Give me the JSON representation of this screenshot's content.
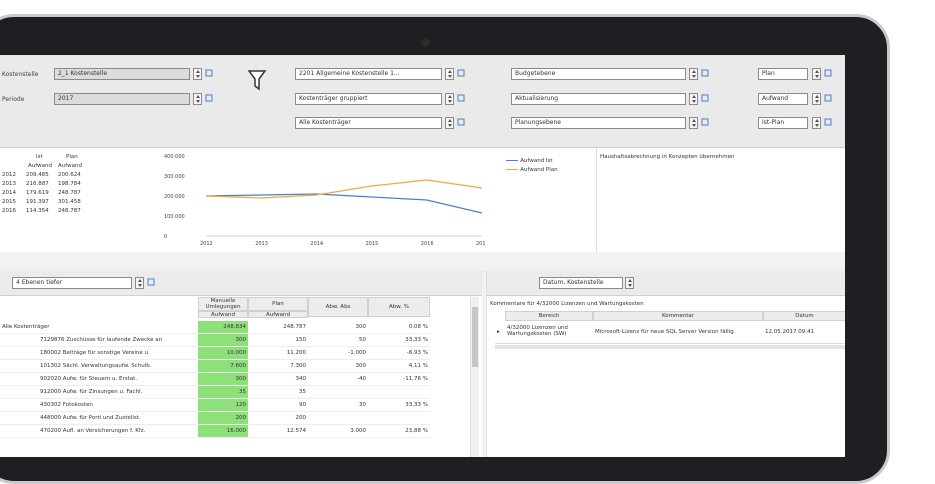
{
  "toolbar": {
    "kostenstelle_label": "Kostenstelle",
    "kostenstelle_value": "2_1 Kostenstelle",
    "periode_label": "Periode",
    "periode_value": "2017",
    "account_group": "2201 Allgemeine Kostenstelle 1...",
    "account_grouping": "Kostenträger gruppiert",
    "account_all": "Alle Kostenträger",
    "budget_1": "Budgetebene",
    "budget_2": "Aktualisierung",
    "budget_3": "Planungsebene",
    "plan_1": "Plan",
    "plan_2": "Aufwand",
    "plan_3": "Ist-Plan"
  },
  "summary": {
    "col_ist": "Ist",
    "col_plan": "Plan",
    "sub_ist": "Aufwand",
    "sub_plan": "Aufwand",
    "rows": [
      {
        "year": "2012",
        "ist": "209.485",
        "plan": "200.624"
      },
      {
        "year": "2013",
        "ist": "216.887",
        "plan": "198.784"
      },
      {
        "year": "2014",
        "ist": "179.619",
        "plan": "248.787"
      },
      {
        "year": "2015",
        "ist": "191.397",
        "plan": "301.458"
      },
      {
        "year": "2016",
        "ist": "114.354",
        "plan": "248.787"
      }
    ]
  },
  "chart_data": {
    "type": "line",
    "x": [
      "2012",
      "2013",
      "2014",
      "2015",
      "2016",
      "2017"
    ],
    "yticks": [
      "400.000",
      "300.000",
      "200.000",
      "100.000",
      "0"
    ],
    "ylim": [
      0,
      400000
    ],
    "series": [
      {
        "name": "Aufwand Ist",
        "color": "#4a7fd0",
        "values": [
          200000,
          205000,
          210000,
          195000,
          180000,
          115000
        ]
      },
      {
        "name": "Aufwand Plan",
        "color": "#f0a840",
        "values": [
          200000,
          190000,
          205000,
          250000,
          280000,
          240000
        ]
      }
    ]
  },
  "notes_title": "Haushaltsabrechnung in Konzepten übernehmen",
  "filter_value": "4 Ebenen tiefer",
  "table": {
    "headers": [
      "Manuelle Umlegungen",
      "Plan",
      "Abw. Abs",
      "Abw. %"
    ],
    "subheaders": [
      "Aufwand",
      "Aufwand"
    ],
    "rows": [
      {
        "name": "Alle Kostenträger",
        "manual": "248.834",
        "plan": "248.787",
        "abs": "300",
        "pct": "0,08 %"
      },
      {
        "name": "7129876 Zuschüsse für laufende Zwecke an",
        "manual": "300",
        "plan": "150",
        "abs": "50",
        "pct": "33,33 %"
      },
      {
        "name": "180002 Beiträge für sonstige Vereine u.",
        "manual": "10.000",
        "plan": "11.200",
        "abs": "-1.000",
        "pct": "-8,93 %"
      },
      {
        "name": "101302 Sächl. Verwaltungsaufw. Schulb.",
        "manual": "7.600",
        "plan": "7.300",
        "abs": "300",
        "pct": "4,11 %"
      },
      {
        "name": "902020 Aufw. für Steuern u. Erstat.",
        "manual": "300",
        "plan": "340",
        "abs": "-40",
        "pct": "-11,76 %"
      },
      {
        "name": "912000 Aufw. für Zinsungen u. Fachl.",
        "manual": "35",
        "plan": "35",
        "abs": "",
        "pct": ""
      },
      {
        "name": "430302 Fotokosten",
        "manual": "120",
        "plan": "90",
        "abs": "30",
        "pct": "33,33 %"
      },
      {
        "name": "448000 Aufw. für Porti und Zustellst.",
        "manual": "200",
        "plan": "200",
        "abs": "",
        "pct": ""
      },
      {
        "name": "470200 Aufl. an Versicherungen f. Kfz.",
        "manual": "16.000",
        "plan": "12.574",
        "abs": "3.000",
        "pct": "23,88 %"
      }
    ]
  },
  "right_panel": {
    "dropdown": "Datum, Kostenstelle",
    "title": "Kommentare für 4/32000 Lizenzen und Wartungskosten",
    "headers": [
      "Bereich",
      "Kommentar",
      "Datum"
    ],
    "row": {
      "bereich": "4/32000 Lizenzen und Wartungskosten (SW)",
      "kommentar": "Microsoft-Lizenz für neue SQL Server Version fällig",
      "datum": "12.05.2017 09:41"
    }
  }
}
